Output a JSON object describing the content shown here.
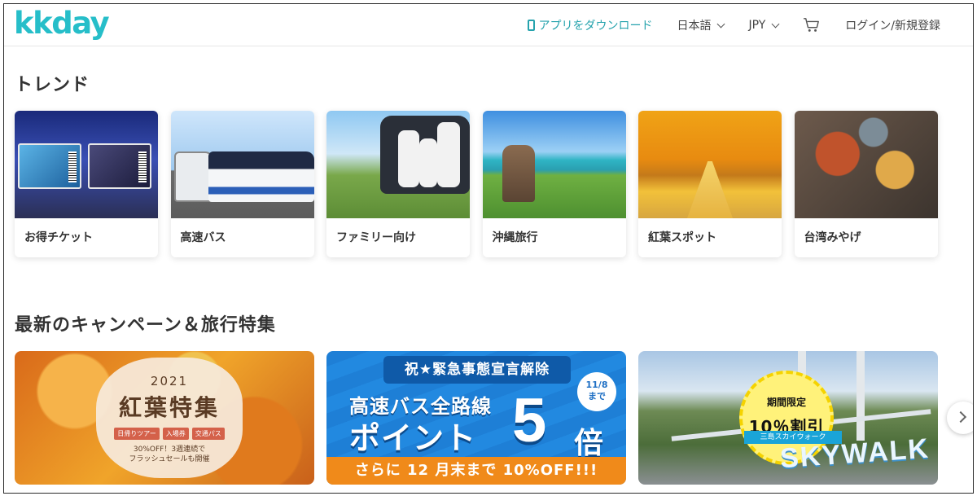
{
  "header": {
    "logo": "kkday",
    "app_download": "アプリをダウンロード",
    "language": "日本語",
    "currency": "JPY",
    "login": "ログイン/新規登録"
  },
  "sections": {
    "trend": {
      "title": "トレンド",
      "cards": [
        {
          "label": "お得チケット",
          "image": "osaka-pass-tickets"
        },
        {
          "label": "高速バス",
          "image": "highway-buses"
        },
        {
          "label": "ファミリー向け",
          "image": "family-car-trip"
        },
        {
          "label": "沖縄旅行",
          "image": "okinawa-shisa-sea"
        },
        {
          "label": "紅葉スポット",
          "image": "autumn-ginkgo-avenue"
        },
        {
          "label": "台湾みやげ",
          "image": "taiwan-food"
        }
      ]
    },
    "campaign": {
      "title": "最新のキャンペーン＆旅行特集",
      "banners": [
        {
          "year": "2021",
          "title": "紅葉特集",
          "tags": [
            "日帰りツアー",
            "入場券",
            "交通パス"
          ],
          "note_line1": "30%OFF！3週連続で",
          "note_line2": "フラッシュセールも開催"
        },
        {
          "top": "祝★緊急事態宣言解除",
          "badge_line1": "11/8",
          "badge_line2": "まで",
          "line1": "高速バス全路線",
          "line2": "ポイント",
          "five": "5",
          "bai": "倍",
          "footer": "さらに 12 月末まで 10%OFF!!!"
        },
        {
          "badge_small": "期間限定",
          "badge_big": "10％割引",
          "ribbon": "三島スカイウォーク",
          "sky": "SKYWALK"
        }
      ]
    }
  },
  "colors": {
    "brand": "#26bec9",
    "app_link": "#26a3ad"
  },
  "icons": [
    "phone-icon",
    "chevron-down-icon",
    "cart-icon",
    "chevron-right-icon"
  ]
}
